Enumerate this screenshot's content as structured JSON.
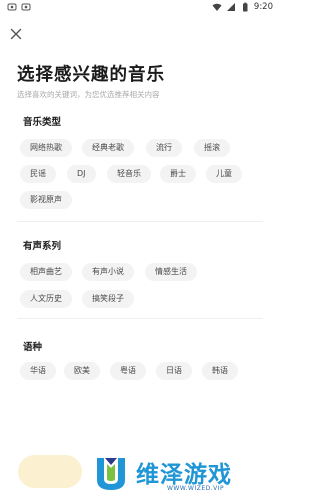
{
  "status_bar": {
    "time": "9:20",
    "left_icons": [
      "notification-icon",
      "notification-icon"
    ],
    "right_icons": [
      "wifi-icon",
      "signal-icon",
      "battery-icon"
    ]
  },
  "header": {
    "close_icon": "close-icon",
    "title": "选择感兴趣的音乐",
    "subtitle": "选择喜欢的关键词，为您优选推荐相关内容"
  },
  "sections": [
    {
      "title": "音乐类型",
      "chips": [
        "网络热歌",
        "经典老歌",
        "流行",
        "摇滚",
        "民谣",
        "DJ",
        "轻音乐",
        "爵士",
        "儿童",
        "影视原声"
      ]
    },
    {
      "title": "有声系列",
      "chips": [
        "相声曲艺",
        "有声小说",
        "情感生活",
        "人文历史",
        "搞笑段子"
      ]
    },
    {
      "title": "语种",
      "chips": [
        "华语",
        "欧美",
        "粤语",
        "日语",
        "韩语"
      ]
    }
  ],
  "watermark": {
    "text": "维泽游戏",
    "url": "WWW.WIZED.VIP"
  },
  "colors": {
    "chip_bg": "#f3f3f3",
    "button_bg": "#fbf0cf",
    "watermark": "#2196d6"
  }
}
